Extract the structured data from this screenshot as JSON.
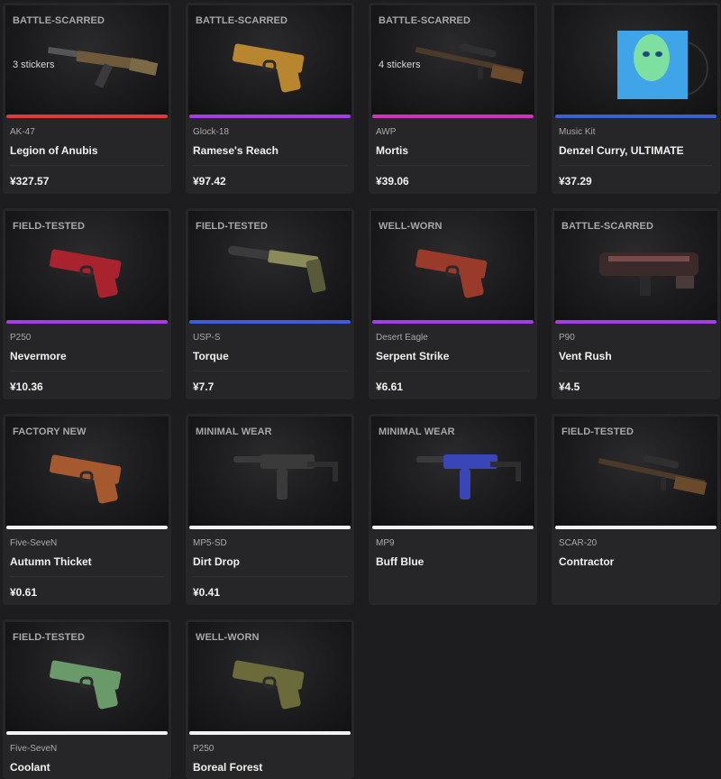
{
  "items": [
    {
      "wear": "BATTLE-SCARRED",
      "stickers": "3 stickers",
      "weapon": "AK-47",
      "skin": "Legion of Anubis",
      "price": "¥327.57",
      "rarity_color": "#e2373b",
      "icon": "rifle-ak47-icon"
    },
    {
      "wear": "BATTLE-SCARRED",
      "stickers": "",
      "weapon": "Glock-18",
      "skin": "Ramese's Reach",
      "price": "¥97.42",
      "rarity_color": "#a73bea",
      "icon": "pistol-icon"
    },
    {
      "wear": "BATTLE-SCARRED",
      "stickers": "4 stickers",
      "weapon": "AWP",
      "skin": "Mortis",
      "price": "¥39.06",
      "rarity_color": "#d52fbf",
      "icon": "sniper-rifle-icon"
    },
    {
      "wear": "",
      "stickers": "",
      "weapon": "Music Kit",
      "skin": "Denzel Curry, ULTIMATE",
      "price": "¥37.29",
      "rarity_color": "#3b5fd9",
      "icon": "music-kit-album-icon"
    },
    {
      "wear": "FIELD-TESTED",
      "stickers": "",
      "weapon": "P250",
      "skin": "Nevermore",
      "price": "¥10.36",
      "rarity_color": "#a73bea",
      "icon": "pistol-icon"
    },
    {
      "wear": "FIELD-TESTED",
      "stickers": "",
      "weapon": "USP-S",
      "skin": "Torque",
      "price": "¥7.7",
      "rarity_color": "#3b5fd9",
      "icon": "silenced-pistol-icon"
    },
    {
      "wear": "WELL-WORN",
      "stickers": "",
      "weapon": "Desert Eagle",
      "skin": "Serpent Strike",
      "price": "¥6.61",
      "rarity_color": "#a73bea",
      "icon": "pistol-icon"
    },
    {
      "wear": "BATTLE-SCARRED",
      "stickers": "",
      "weapon": "P90",
      "skin": "Vent Rush",
      "price": "¥4.5",
      "rarity_color": "#a73bea",
      "icon": "smg-p90-icon"
    },
    {
      "wear": "FACTORY NEW",
      "stickers": "",
      "weapon": "Five-SeveN",
      "skin": "Autumn Thicket",
      "price": "¥0.61",
      "rarity_color": "#f2f2f2",
      "icon": "pistol-icon"
    },
    {
      "wear": "MINIMAL WEAR",
      "stickers": "",
      "weapon": "MP5-SD",
      "skin": "Dirt Drop",
      "price": "¥0.41",
      "rarity_color": "#f2f2f2",
      "icon": "smg-icon"
    },
    {
      "wear": "MINIMAL WEAR",
      "stickers": "",
      "weapon": "MP9",
      "skin": "Buff Blue",
      "price": "",
      "rarity_color": "#f2f2f2",
      "icon": "smg-icon"
    },
    {
      "wear": "FIELD-TESTED",
      "stickers": "",
      "weapon": "SCAR-20",
      "skin": "Contractor",
      "price": "",
      "rarity_color": "#f2f2f2",
      "icon": "sniper-rifle-icon"
    },
    {
      "wear": "FIELD-TESTED",
      "stickers": "",
      "weapon": "Five-SeveN",
      "skin": "Coolant",
      "price": "",
      "rarity_color": "#f2f2f2",
      "icon": "pistol-icon"
    },
    {
      "wear": "WELL-WORN",
      "stickers": "",
      "weapon": "P250",
      "skin": "Boreal Forest",
      "price": "",
      "rarity_color": "#f2f2f2",
      "icon": "pistol-icon"
    }
  ]
}
